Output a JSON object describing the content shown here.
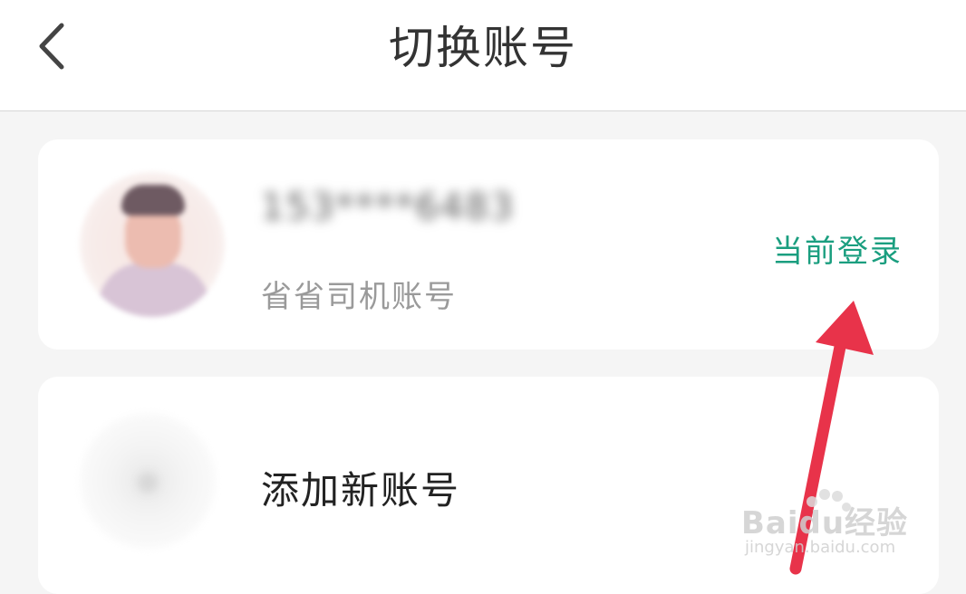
{
  "header": {
    "title": "切换账号",
    "back_icon": "chevron-left-icon"
  },
  "accounts": [
    {
      "masked_name": "153****6483",
      "type_label": "省省司机账号",
      "status_label": "当前登录",
      "status_color": "#1a9e7f"
    }
  ],
  "add_account": {
    "label": "添加新账号"
  },
  "watermark": {
    "brand": "Baidu经验",
    "url": "jingyan.baidu.com"
  },
  "annotation_arrow_color": "#e8334a"
}
